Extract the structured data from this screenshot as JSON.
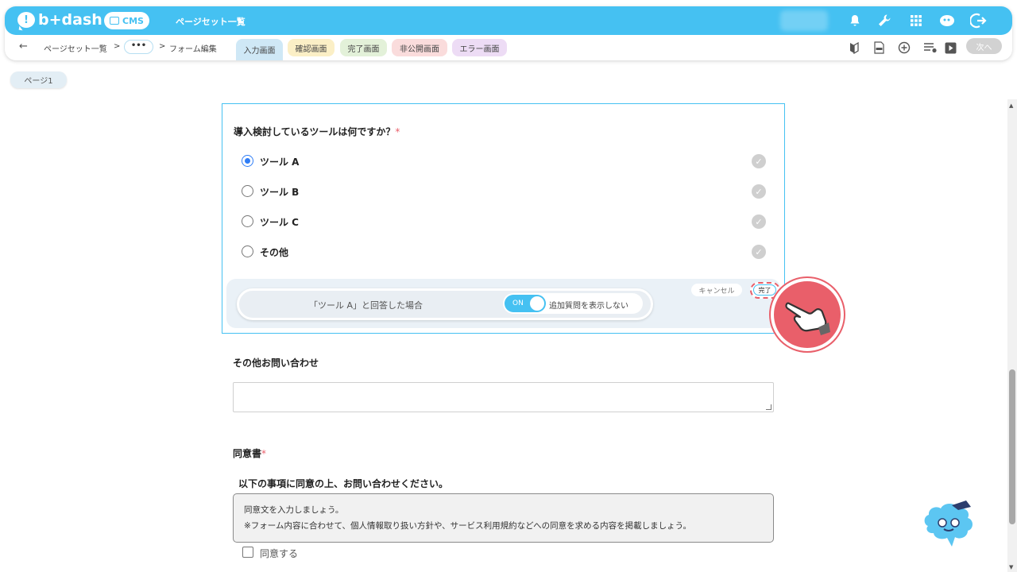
{
  "header": {
    "logo_text": "b+dash",
    "cms_label": "CMS",
    "title": "ページセット一覧",
    "icons": [
      "bell-icon",
      "wrench-icon",
      "grid-icon",
      "chat-ai-icon",
      "logout-icon"
    ]
  },
  "breadcrumb": {
    "first": "ページセット一覧",
    "sep1": ">",
    "ellipsis": "•••",
    "sep2": ">",
    "current": "フォーム編集"
  },
  "stage_tabs": {
    "input": "入力画面",
    "confirm": "確認画面",
    "complete": "完了画面",
    "private": "非公開画面",
    "error": "エラー画面"
  },
  "toolbar": {
    "icons": [
      "beginner-mark-icon",
      "html-file-icon",
      "add-circle-icon",
      "list-settings-icon",
      "play-icon"
    ],
    "next_label": "次へ"
  },
  "page_pill": "ページ1",
  "question": {
    "title": "導入検討しているツールは何ですか？",
    "required_mark": "*",
    "options": [
      {
        "label": "ツール A",
        "selected": true
      },
      {
        "label": "ツール B",
        "selected": false
      },
      {
        "label": "ツール C",
        "selected": false
      },
      {
        "label": "その他",
        "selected": false
      }
    ],
    "condition": {
      "text": "「ツール A」と回答した場合",
      "toggle_label": "ON",
      "toggle_desc": "追加質問を表示しない",
      "toggle_on": true
    },
    "cancel_label": "キャンセル",
    "done_label": "完了"
  },
  "other_inquiry": {
    "label": "その他お問い合わせ"
  },
  "consent": {
    "label": "同意書",
    "required_mark": "*",
    "heading": "以下の事項に同意の上、お問い合わせください。",
    "line1": "同意文を入力しましょう。",
    "line2": "※フォーム内容に合わせて、個人情報取り扱い方針や、サービス利用規約などへの同意を求める内容を掲載しましょう。",
    "checkbox_label": "同意する"
  }
}
